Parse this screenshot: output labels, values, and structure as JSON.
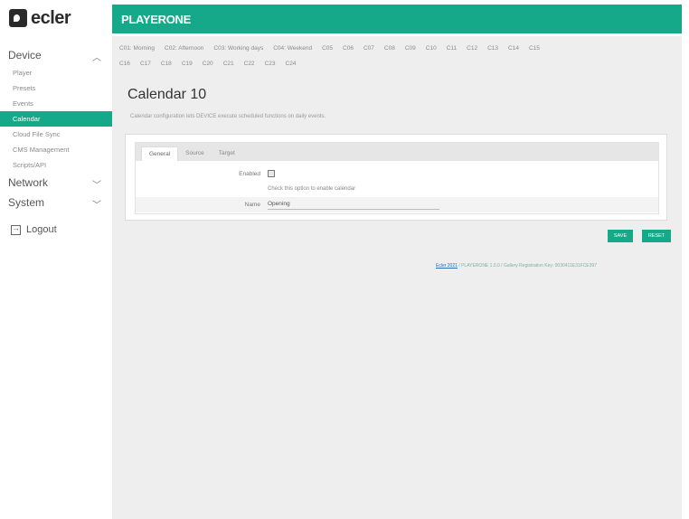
{
  "brand": {
    "logo_text": "ecler",
    "app_name": "PLAYERONE"
  },
  "sidebar": {
    "device": {
      "label": "Device",
      "items": [
        "Player",
        "Presets",
        "Events",
        "Calendar",
        "Cloud File Sync",
        "CMS Management",
        "Scripts/API"
      ]
    },
    "network": {
      "label": "Network"
    },
    "system": {
      "label": "System"
    },
    "logout": "Logout"
  },
  "calendar_tabs": {
    "row1": [
      "C01: Morning",
      "C02: Afternoon",
      "C03: Working days",
      "C04: Weekend",
      "C05",
      "C06",
      "C07",
      "C08",
      "C09",
      "C10",
      "C11",
      "C12",
      "C13",
      "C14",
      "C15"
    ],
    "row2": [
      "C16",
      "C17",
      "C18",
      "C19",
      "C20",
      "C21",
      "C22",
      "C23",
      "C24"
    ]
  },
  "page": {
    "title": "Calendar 10",
    "description": "Calendar configuration lets DEVICE execute scheduled functions on daily events."
  },
  "form": {
    "tabs": [
      "General",
      "Source",
      "Target"
    ],
    "enabled_label": "Enabled",
    "enabled_hint": "Check this option to enable calendar",
    "name_label": "Name",
    "name_value": "Opening"
  },
  "buttons": {
    "save": "SAVE",
    "reset": "RESET"
  },
  "footer": {
    "link": "Ecler 2021",
    "text": " / PLAYERONE 1.0.0 / Gallery Registration Key: 0030411E31FCE397"
  },
  "colors": {
    "accent": "#15a98a"
  }
}
